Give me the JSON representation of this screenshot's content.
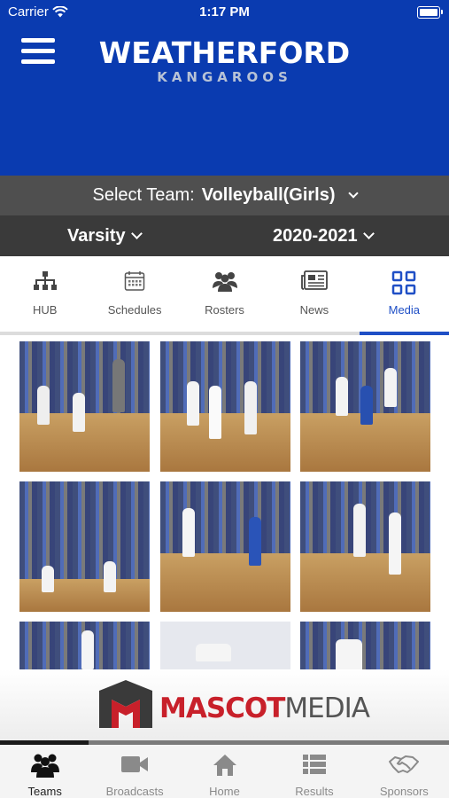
{
  "status_bar": {
    "carrier": "Carrier",
    "time": "1:17 PM"
  },
  "brand": {
    "name_line1": "WEATHERFORD",
    "name_line2": "KANGAROOS",
    "header_color": "#0a3bb0"
  },
  "team_selector": {
    "label": "Select Team:",
    "value": "Volleyball(Girls)"
  },
  "filters": {
    "level": "Varsity",
    "season": "2020-2021"
  },
  "tabs": [
    {
      "label": "HUB",
      "icon": "hierarchy-icon"
    },
    {
      "label": "Schedules",
      "icon": "calendar-icon"
    },
    {
      "label": "Rosters",
      "icon": "people-icon"
    },
    {
      "label": "News",
      "icon": "newspaper-icon"
    },
    {
      "label": "Media",
      "icon": "grid-icon",
      "active": true
    }
  ],
  "media": {
    "photos": [
      {
        "subject": "volleyball-photo"
      },
      {
        "subject": "volleyball-photo"
      },
      {
        "subject": "volleyball-photo"
      },
      {
        "subject": "volleyball-photo"
      },
      {
        "subject": "volleyball-photo"
      },
      {
        "subject": "volleyball-photo"
      },
      {
        "subject": "volleyball-photo"
      },
      {
        "subject": "volleyball-photo"
      },
      {
        "subject": "volleyball-photo"
      }
    ]
  },
  "sponsor_banner": {
    "word1": "MASCOT",
    "word2": "MEDIA",
    "accent": "#c8202a"
  },
  "bottom_nav": [
    {
      "label": "Teams",
      "icon": "team-icon",
      "active": true
    },
    {
      "label": "Broadcasts",
      "icon": "video-camera-icon"
    },
    {
      "label": "Home",
      "icon": "home-icon"
    },
    {
      "label": "Results",
      "icon": "list-icon"
    },
    {
      "label": "Sponsors",
      "icon": "handshake-icon"
    }
  ]
}
